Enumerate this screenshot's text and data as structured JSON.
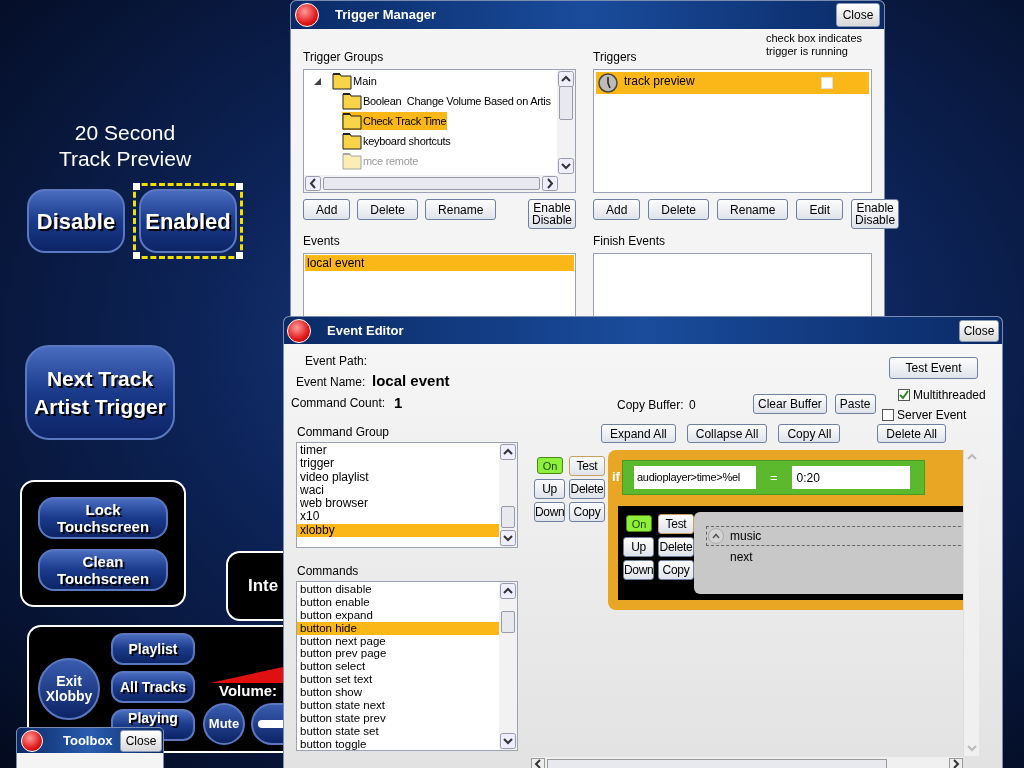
{
  "canvas": {
    "caption": "20 Second\nTrack Preview",
    "toggle_buttons": [
      {
        "label": "Disable",
        "selected": false
      },
      {
        "label": "Enabled",
        "selected": true
      }
    ],
    "trigger_button": "Next Track\nArtist Trigger",
    "touch_buttons": [
      "Lock\nTouchscreen",
      "Clean\nTouchscreen"
    ],
    "partial_panel": "Inte",
    "player": {
      "exit": "Exit\nXlobby",
      "buttons": [
        "Playlist",
        "All Tracks",
        "Playing"
      ],
      "volume_label": "Volume:",
      "mute": "Mute"
    }
  },
  "trigger_manager": {
    "title": "Trigger Manager",
    "close": "Close",
    "groups_label": "Trigger Groups",
    "tree": [
      {
        "label": "Main",
        "expanded": true,
        "children": [
          {
            "label": "Boolean  Change Volume Based on Artis",
            "selected": false,
            "disabled": false
          },
          {
            "label": "Check Track Time",
            "selected": true,
            "disabled": false
          },
          {
            "label": "keyboard shortcuts",
            "selected": false,
            "disabled": false
          },
          {
            "label": "mce remote",
            "selected": false,
            "disabled": true
          }
        ]
      }
    ],
    "group_buttons": [
      "Add",
      "Delete",
      "Rename",
      "Enable\nDisable"
    ],
    "triggers_label": "Triggers",
    "note": "check box indicates\ntrigger is running",
    "triggers": [
      {
        "label": "track preview",
        "selected": true,
        "running": false
      }
    ],
    "trigger_buttons": [
      "Add",
      "Delete",
      "Rename",
      "Edit",
      "Enable\nDisable"
    ],
    "events_label": "Events",
    "events": [
      {
        "label": "local event",
        "selected": true
      }
    ],
    "finish_events_label": "Finish Events"
  },
  "event_editor": {
    "title": "Event Editor",
    "close": "Close",
    "path_label": "Event Path:",
    "name_label": "Event Name:",
    "name_value": "local event",
    "count_label": "Command Count:",
    "count_value": "1",
    "buffer_label": "Copy Buffer:",
    "buffer_value": "0",
    "buffer_buttons": [
      "Clear Buffer",
      "Paste"
    ],
    "test_button": "Test Event",
    "options": [
      {
        "label": "Multithreaded",
        "checked": true
      },
      {
        "label": "Server Event",
        "checked": false
      }
    ],
    "toolbar": [
      "Expand All",
      "Collapse All",
      "Copy All",
      "Delete All"
    ],
    "group_label": "Command Group",
    "groups": [
      {
        "label": "timer",
        "selected": false
      },
      {
        "label": "trigger",
        "selected": false
      },
      {
        "label": "video playlist",
        "selected": false
      },
      {
        "label": "waci",
        "selected": false
      },
      {
        "label": "web browser",
        "selected": false
      },
      {
        "label": "x10",
        "selected": false
      },
      {
        "label": "xlobby",
        "selected": true
      }
    ],
    "commands_label": "Commands",
    "commands": [
      {
        "label": "button disable",
        "selected": false
      },
      {
        "label": "button enable",
        "selected": false
      },
      {
        "label": "button expand",
        "selected": false
      },
      {
        "label": "button hide",
        "selected": true
      },
      {
        "label": "button next page",
        "selected": false
      },
      {
        "label": "button prev page",
        "selected": false
      },
      {
        "label": "button select",
        "selected": false
      },
      {
        "label": "button set text",
        "selected": false
      },
      {
        "label": "button show",
        "selected": false
      },
      {
        "label": "button state next",
        "selected": false
      },
      {
        "label": "button state prev",
        "selected": false
      },
      {
        "label": "button state set",
        "selected": false
      },
      {
        "label": "button toggle",
        "selected": false
      }
    ],
    "block": {
      "switch": {
        "label": "On",
        "on": true
      },
      "buttons": [
        "Test",
        "Up",
        "Delete",
        "Down",
        "Copy"
      ],
      "keyword": "if",
      "left": "audioplayer>time>%el",
      "op": "=",
      "right": "0:20",
      "action": {
        "switch": {
          "label": "On",
          "on": true
        },
        "buttons": [
          "Test",
          "Up",
          "Delete",
          "Down",
          "Copy"
        ],
        "lines": [
          "music",
          "next"
        ]
      }
    }
  },
  "toolbox": {
    "title": "Toolbox",
    "close": "Close"
  }
}
